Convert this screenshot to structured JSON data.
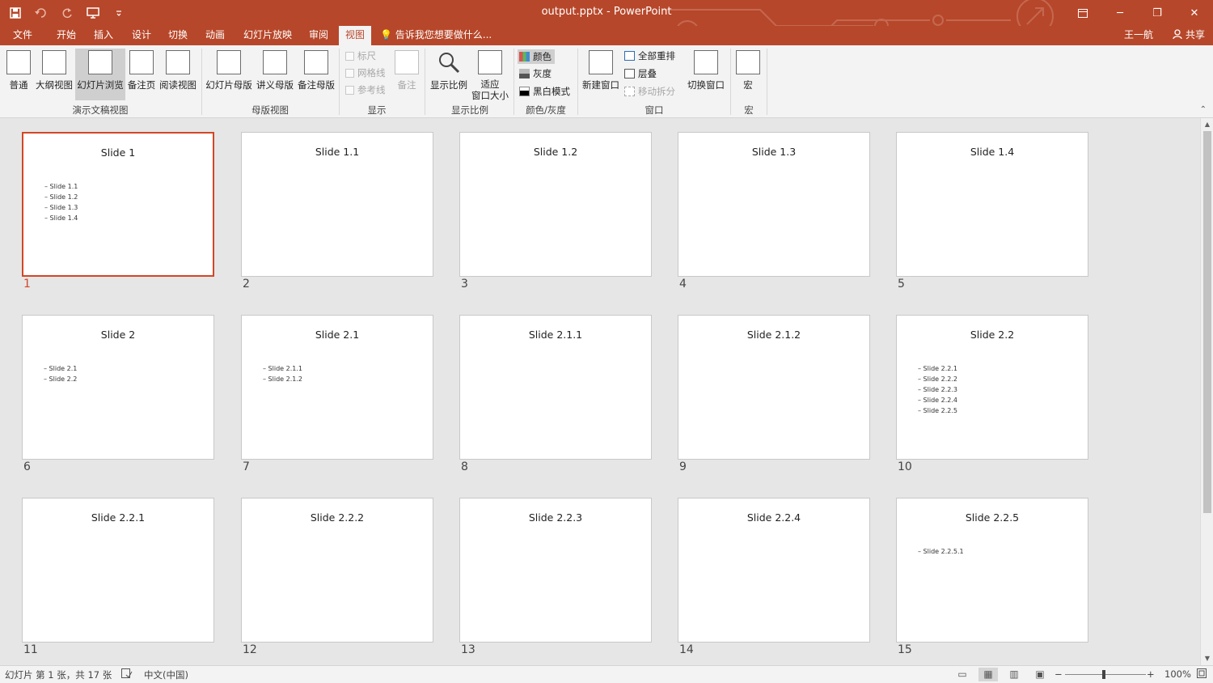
{
  "window": {
    "title": "output.pptx - PowerPoint",
    "restore_icon": "ribbon-display-options-icon",
    "minimize": "─",
    "maximize": "❐",
    "close": "✕"
  },
  "qat": {
    "save": "💾",
    "undo": "↶",
    "redo": "↻",
    "present": "🖵",
    "more": "⌄"
  },
  "tabs": [
    {
      "label": "文件"
    },
    {
      "label": "开始"
    },
    {
      "label": "插入"
    },
    {
      "label": "设计"
    },
    {
      "label": "切换"
    },
    {
      "label": "动画"
    },
    {
      "label": "幻灯片放映"
    },
    {
      "label": "审阅"
    },
    {
      "label": "视图"
    }
  ],
  "tell_me": "告诉我您想要做什么...",
  "user": "王一航",
  "share": "共享",
  "ribbon": {
    "presentation_views": {
      "label": "演示文稿视图",
      "buttons": [
        "普通",
        "大纲视图",
        "幻灯片浏览",
        "备注页",
        "阅读视图"
      ]
    },
    "master_views": {
      "label": "母版视图",
      "buttons": [
        "幻灯片母版",
        "讲义母版",
        "备注母版"
      ]
    },
    "show": {
      "label": "显示",
      "checks": [
        "标尺",
        "网格线",
        "参考线"
      ],
      "notes": "备注"
    },
    "zoom": {
      "label": "显示比例",
      "zoom": "显示比例",
      "fit_1": "适应",
      "fit_2": "窗口大小"
    },
    "color": {
      "label": "颜色/灰度",
      "items": [
        "颜色",
        "灰度",
        "黑白模式"
      ]
    },
    "window": {
      "label": "窗口",
      "new_window": "新建窗口",
      "arrange_all": "全部重排",
      "cascade": "层叠",
      "move_split": "移动拆分",
      "switch": "切换窗口"
    },
    "macros": {
      "label": "宏",
      "button": "宏"
    }
  },
  "slides": [
    {
      "num": "1",
      "title": "Slide 1",
      "bullets": [
        "Slide 1.1",
        "Slide 1.2",
        "Slide 1.3",
        "Slide 1.4"
      ],
      "selected": true
    },
    {
      "num": "2",
      "title": "Slide 1.1",
      "bullets": []
    },
    {
      "num": "3",
      "title": "Slide 1.2",
      "bullets": []
    },
    {
      "num": "4",
      "title": "Slide 1.3",
      "bullets": []
    },
    {
      "num": "5",
      "title": "Slide 1.4",
      "bullets": []
    },
    {
      "num": "6",
      "title": "Slide 2",
      "bullets": [
        "Slide 2.1",
        "Slide 2.2"
      ]
    },
    {
      "num": "7",
      "title": "Slide 2.1",
      "bullets": [
        "Slide 2.1.1",
        "Slide 2.1.2"
      ]
    },
    {
      "num": "8",
      "title": "Slide 2.1.1",
      "bullets": []
    },
    {
      "num": "9",
      "title": "Slide 2.1.2",
      "bullets": []
    },
    {
      "num": "10",
      "title": "Slide 2.2",
      "bullets": [
        "Slide 2.2.1",
        "Slide 2.2.2",
        "Slide 2.2.3",
        "Slide 2.2.4",
        "Slide 2.2.5"
      ]
    },
    {
      "num": "11",
      "title": "Slide 2.2.1",
      "bullets": []
    },
    {
      "num": "12",
      "title": "Slide 2.2.2",
      "bullets": []
    },
    {
      "num": "13",
      "title": "Slide 2.2.3",
      "bullets": []
    },
    {
      "num": "14",
      "title": "Slide 2.2.4",
      "bullets": []
    },
    {
      "num": "15",
      "title": "Slide 2.2.5",
      "bullets": [
        "Slide 2.2.5.1"
      ]
    }
  ],
  "status": {
    "slide_info": "幻灯片 第 1 张，共 17 张",
    "language": "中文(中国)",
    "zoom_minus": "−",
    "zoom_plus": "+",
    "zoom": "100%"
  },
  "colors": {
    "accent": "#b7472a",
    "selected_border": "#d24726"
  }
}
